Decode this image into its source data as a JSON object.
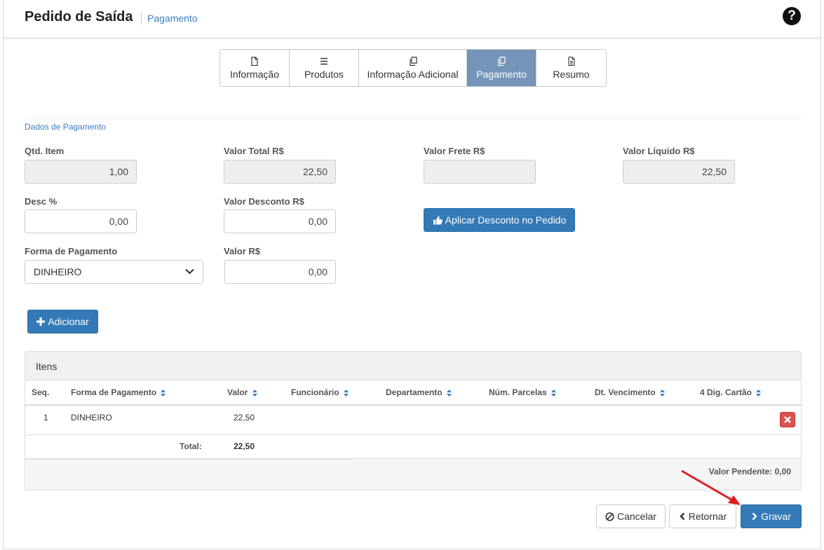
{
  "header": {
    "title": "Pedido de Saída",
    "breadcrumb": "Pagamento"
  },
  "tabs": [
    {
      "label": "Informação",
      "icon": "file-icon",
      "active": false
    },
    {
      "label": "Produtos",
      "icon": "list-icon",
      "active": false
    },
    {
      "label": "Informação Adicional",
      "icon": "copy-icon",
      "active": false
    },
    {
      "label": "Pagamento",
      "icon": "copy-icon",
      "active": true
    },
    {
      "label": "Resumo",
      "icon": "file-text-icon",
      "active": false
    }
  ],
  "section": {
    "title": "Dados de Pagamento"
  },
  "fields": {
    "qtd_item": {
      "label": "Qtd. Item",
      "value": "1,00"
    },
    "valor_total": {
      "label": "Valor Total R$",
      "value": "22,50"
    },
    "valor_frete": {
      "label": "Valor Frete R$",
      "value": ""
    },
    "valor_liquido": {
      "label": "Valor Líquido R$",
      "value": "22,50"
    },
    "desc_pct": {
      "label": "Desc %",
      "value": "0,00"
    },
    "valor_desconto": {
      "label": "Valor Desconto R$",
      "value": "0,00"
    },
    "forma_pagamento": {
      "label": "Forma de Pagamento",
      "value": "DINHEIRO"
    },
    "valor": {
      "label": "Valor R$",
      "value": "0,00"
    }
  },
  "buttons": {
    "aplicar_desconto": "Aplicar Desconto no Pedido",
    "adicionar": "Adicionar",
    "cancelar": "Cancelar",
    "retornar": "Retornar",
    "gravar": "Gravar"
  },
  "items_panel": {
    "title": "Itens",
    "columns": [
      "Seq.",
      "Forma de Pagamento",
      "Valor",
      "Funcionário",
      "Departamento",
      "Núm. Parcelas",
      "Dt. Vencimento",
      "4 Dig. Cartão"
    ],
    "rows": [
      {
        "seq": "1",
        "forma": "DINHEIRO",
        "valor": "22,50"
      }
    ],
    "total_label": "Total:",
    "total_value": "22,50",
    "pending": "Valor Pendente: 0,00"
  },
  "colors": {
    "primary": "#337ab7",
    "tab_active": "#7494b8",
    "danger": "#d9534f",
    "annotation_arrow": "#e02020"
  }
}
